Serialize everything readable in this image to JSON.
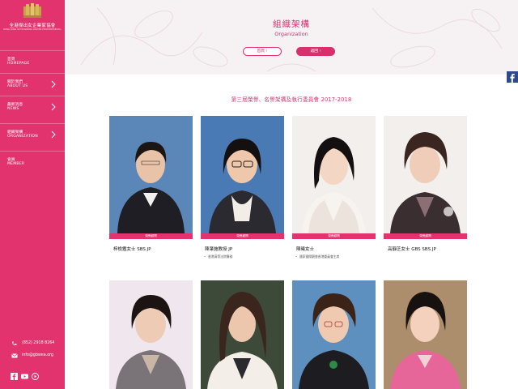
{
  "sidebar": {
    "logo": {
      "name": "全港傑出女企業家協會",
      "subtitle": "HONG KONG OUTSTANDING WOMEN ENTREPRENEURS ASSOCIATION"
    },
    "items": [
      {
        "zh": "首頁",
        "en": "HOMEPAGE"
      },
      {
        "zh": "關於我們",
        "en": "ABOUT US"
      },
      {
        "zh": "最新消息",
        "en": "NEWS"
      },
      {
        "zh": "組織架構",
        "en": "ORGANIZATION"
      },
      {
        "zh": "會員",
        "en": "MEMBER"
      }
    ],
    "phone": "(852) 2918 8264",
    "email": "info@gbwea.org"
  },
  "header": {
    "title_zh": "組織架構",
    "title_en": "Organization",
    "home_button": "首頁",
    "back_button": "返回"
  },
  "section": {
    "title": "第三屆榮譽、名譽架構及執行委員會 2017-2018"
  },
  "members": [
    {
      "badge": "榮譽顧問",
      "name": "梓檢鑑女士 SBS JP",
      "role": ""
    },
    {
      "badge": "榮譽顧問",
      "name": "陳肇施教授 JP",
      "role": "香港高等法院醫務"
    },
    {
      "badge": "榮譽顧問",
      "name": "陳曦女士",
      "role": "國家國際觀書香港委員會主席"
    },
    {
      "badge": "榮譽顧問",
      "name": "高靜芝女士 GBS SBS JP",
      "role": ""
    }
  ],
  "colors": {
    "accent": "#e2336f",
    "accent_dark": "#d8306d",
    "facebook": "#2f4a8a"
  }
}
